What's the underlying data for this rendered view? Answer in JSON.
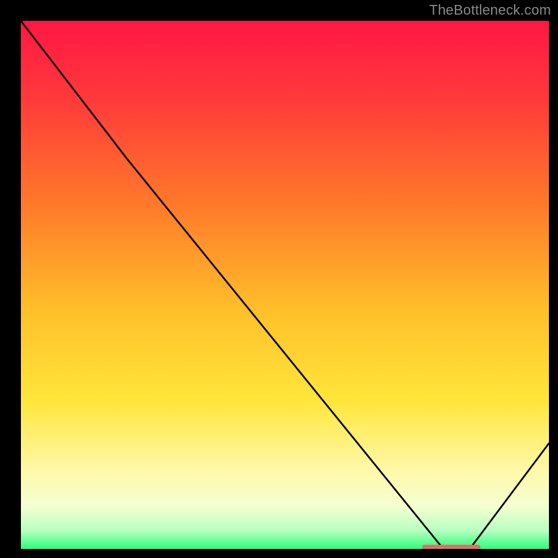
{
  "attribution": "TheBottleneck.com",
  "chart_data": {
    "type": "line",
    "title": "",
    "xlabel": "",
    "ylabel": "",
    "xlim": [
      0,
      100
    ],
    "ylim": [
      0,
      100
    ],
    "grid": false,
    "curve": [
      {
        "x": 0,
        "y": 100
      },
      {
        "x": 20,
        "y": 74
      },
      {
        "x": 80,
        "y": 0
      },
      {
        "x": 85,
        "y": 0
      },
      {
        "x": 100,
        "y": 20
      }
    ],
    "marker_band": {
      "x_start": 76,
      "x_end": 87,
      "y": 0,
      "color": "#d9736a"
    },
    "background_gradient": {
      "stops": [
        {
          "offset": 0.0,
          "color": "#ff1744"
        },
        {
          "offset": 0.15,
          "color": "#ff3a3a"
        },
        {
          "offset": 0.35,
          "color": "#ff7a2a"
        },
        {
          "offset": 0.55,
          "color": "#ffc02a"
        },
        {
          "offset": 0.72,
          "color": "#ffe63a"
        },
        {
          "offset": 0.85,
          "color": "#fff8a8"
        },
        {
          "offset": 0.92,
          "color": "#f4ffd0"
        },
        {
          "offset": 0.965,
          "color": "#b8ffc0"
        },
        {
          "offset": 1.0,
          "color": "#2cff7a"
        }
      ]
    }
  }
}
